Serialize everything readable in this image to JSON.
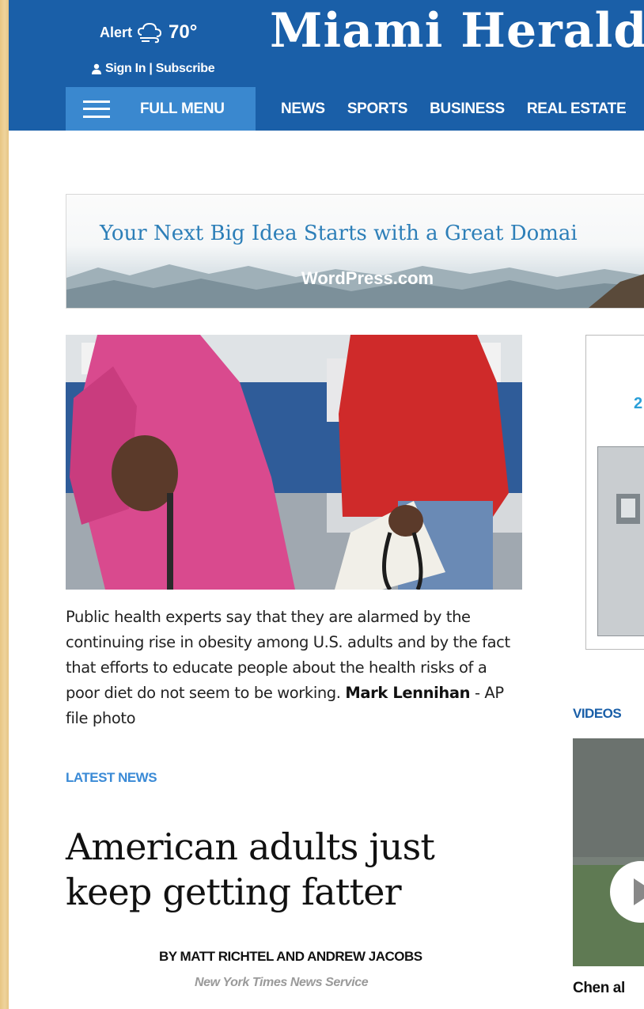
{
  "header": {
    "alert_label": "Alert",
    "temperature": "70°",
    "signin_label": "Sign In | Subscribe",
    "logo_text": "Miami Herald",
    "menu_label": "FULL MENU",
    "nav_links": [
      "NEWS",
      "SPORTS",
      "BUSINESS",
      "REAL ESTATE"
    ]
  },
  "ad_banner": {
    "headline": "Your Next Big Idea Starts with a Great Domai",
    "brand": "WordPress.com"
  },
  "article": {
    "caption_text": "Public health experts say that they are alarmed by the continuing rise in obesity among U.S. adults and by the fact that efforts to educate people about the health risks of a poor diet do not seem to be working.",
    "photo_credit_name": "Mark Lennihan",
    "photo_credit_source": " - AP file photo",
    "section_label": "LATEST NEWS",
    "headline": "American adults just keep getting fatter",
    "byline": "BY MATT RICHTEL AND ANDREW JACOBS",
    "source": "New York Times News Service"
  },
  "sidebar": {
    "ad_partial_text": "2",
    "videos_label": "VIDEOS",
    "video_title_partial": "Chen al"
  },
  "colors": {
    "brand_blue": "#1a5fa8",
    "menu_blue": "#3a88cf",
    "section_blue": "#3a8ad6"
  }
}
